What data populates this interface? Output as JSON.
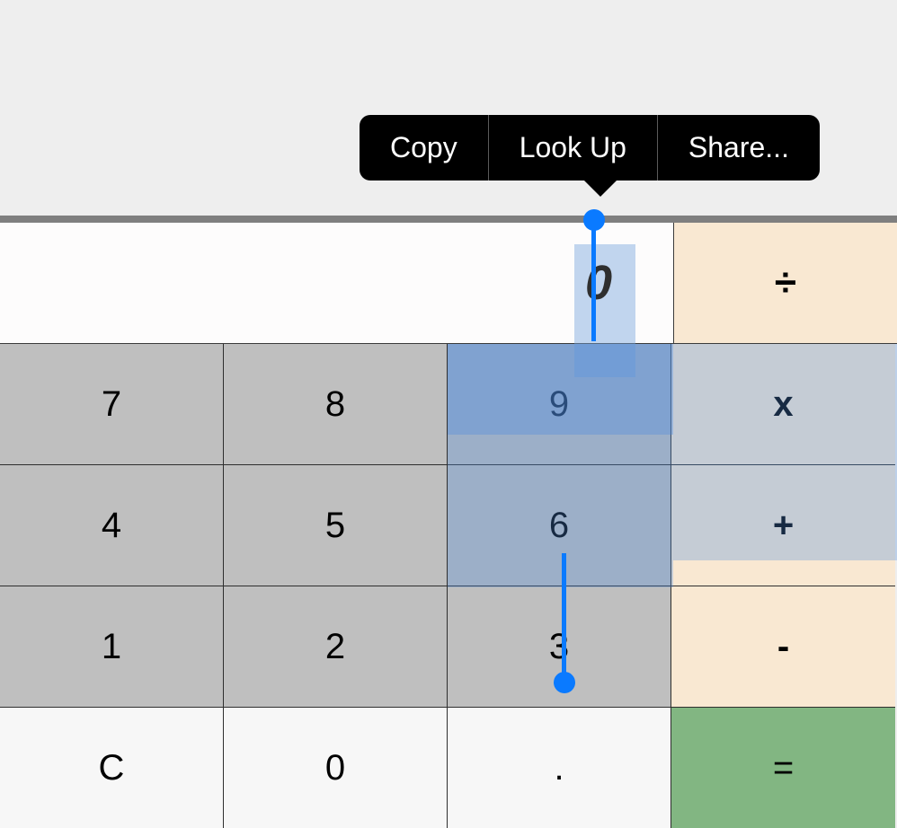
{
  "context_menu": {
    "copy": "Copy",
    "lookup": "Look Up",
    "share": "Share..."
  },
  "display": {
    "value": "0"
  },
  "operators": {
    "divide": "÷",
    "multiply": "x",
    "plus": "+",
    "minus": "-",
    "equals": "="
  },
  "keys": {
    "n7": "7",
    "n8": "8",
    "n9": "9",
    "n4": "4",
    "n5": "5",
    "n6": "6",
    "n1": "1",
    "n2": "2",
    "n3": "3",
    "clear": "C",
    "n0": "0",
    "dot": "."
  }
}
